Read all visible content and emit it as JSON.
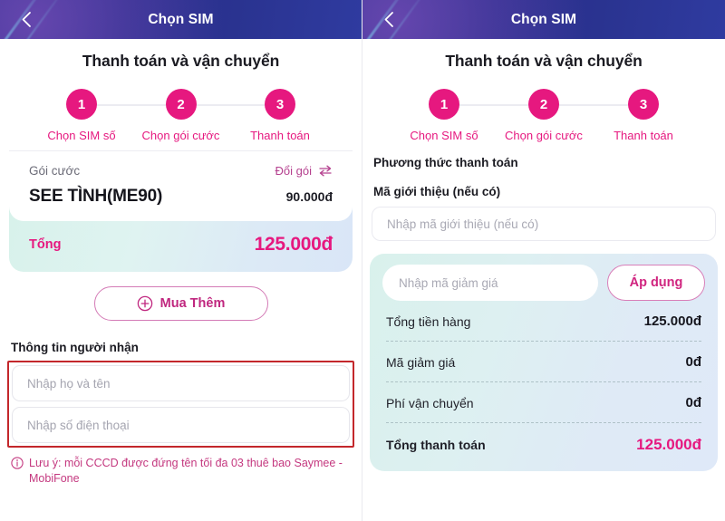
{
  "appbar": {
    "title": "Chọn SIM",
    "back_icon": "chevron-left-icon"
  },
  "page": {
    "title": "Thanh toán và vận chuyển"
  },
  "stepper": {
    "steps": [
      {
        "number": "1",
        "label": "Chọn SIM số"
      },
      {
        "number": "2",
        "label": "Chọn gói cước"
      },
      {
        "number": "3",
        "label": "Thanh toán"
      }
    ]
  },
  "left": {
    "plan_card": {
      "label": "Gói cước",
      "change_label": "Đổi gói",
      "change_icon": "swap-horizontal-icon",
      "plan_name": "SEE TÌNH(ME90)",
      "plan_price": "90.000đ",
      "total_label": "Tổng",
      "total_value": "125.000đ"
    },
    "buy_more": {
      "label": "Mua Thêm",
      "icon": "plus-circle-icon"
    },
    "recipient": {
      "section_title": "Thông tin người nhận",
      "name_value": "",
      "name_placeholder": "Nhập họ và tên",
      "phone_value": "",
      "phone_placeholder": "Nhập số điện thoại"
    },
    "note": {
      "icon": "info-circle-icon",
      "text": "Lưu ý: mỗi CCCD được đứng tên tối đa 03 thuê bao Saymee - MobiFone"
    }
  },
  "right": {
    "payment_method_title": "Phương thức thanh toán",
    "referral_title": "Mã giới thiệu (nếu có)",
    "referral_value": "",
    "referral_placeholder": "Nhập mã giới thiệu (nếu có)",
    "promo": {
      "value": "",
      "placeholder": "Nhập mã giảm giá",
      "apply_label": "Áp dụng"
    },
    "summary_rows": [
      {
        "label": "Tổng tiền hàng",
        "value": "125.000đ"
      },
      {
        "label": "Mã giảm giá",
        "value": "0đ"
      },
      {
        "label": "Phí vận chuyển",
        "value": "0đ"
      },
      {
        "label": "Tổng thanh toán",
        "value": "125.000đ"
      }
    ]
  },
  "colors": {
    "brand_pink": "#e6187f",
    "header_blue": "#2b2f8f",
    "highlight_red": "#c3272b"
  }
}
